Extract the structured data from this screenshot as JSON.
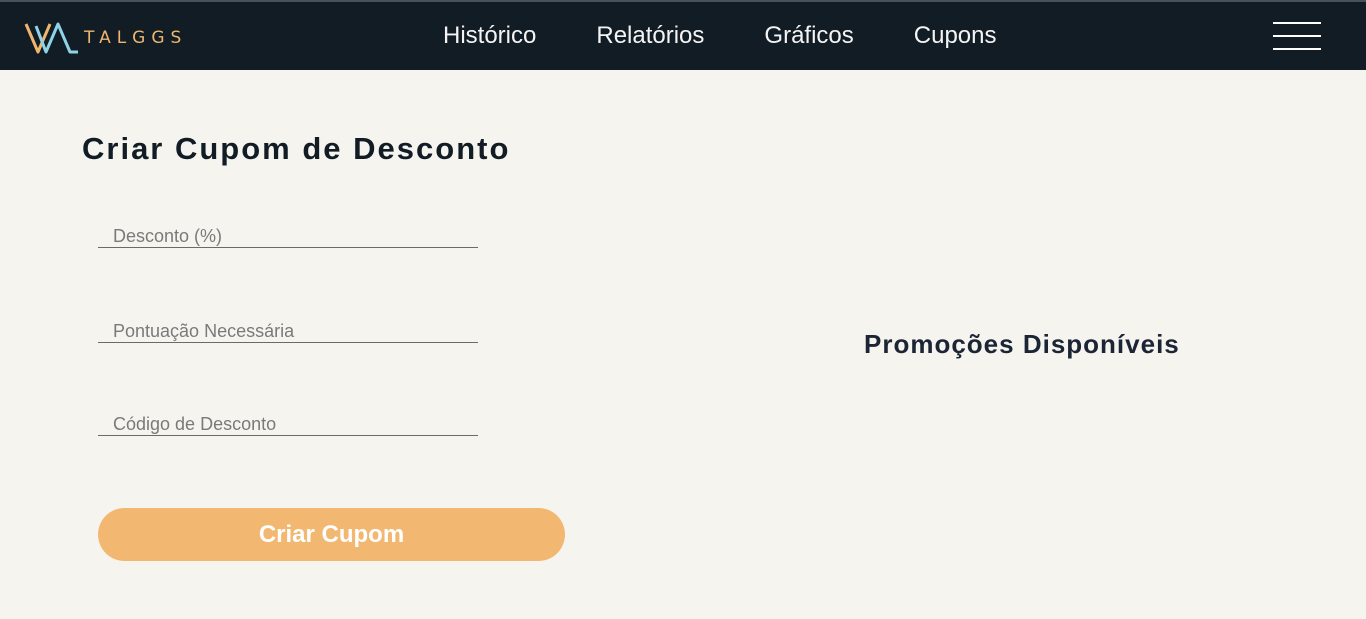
{
  "header": {
    "logo_text": "TALGGS",
    "nav": [
      {
        "label": "Histórico"
      },
      {
        "label": "Relatórios"
      },
      {
        "label": "Gráficos"
      },
      {
        "label": "Cupons"
      }
    ],
    "menu_icon": "hamburger-menu-icon"
  },
  "form": {
    "title": "Criar Cupom de Desconto",
    "fields": [
      {
        "placeholder": "Desconto (%)",
        "value": ""
      },
      {
        "placeholder": "Pontuação Necessária",
        "value": ""
      },
      {
        "placeholder": "Código de Desconto",
        "value": ""
      }
    ],
    "submit_label": "Criar Cupom"
  },
  "promotions": {
    "title": "Promoções Disponíveis"
  },
  "colors": {
    "header_bg": "#111c25",
    "accent": "#f2b872",
    "logo_blue": "#8fd3e8",
    "page_bg": "#f6f4ee"
  }
}
